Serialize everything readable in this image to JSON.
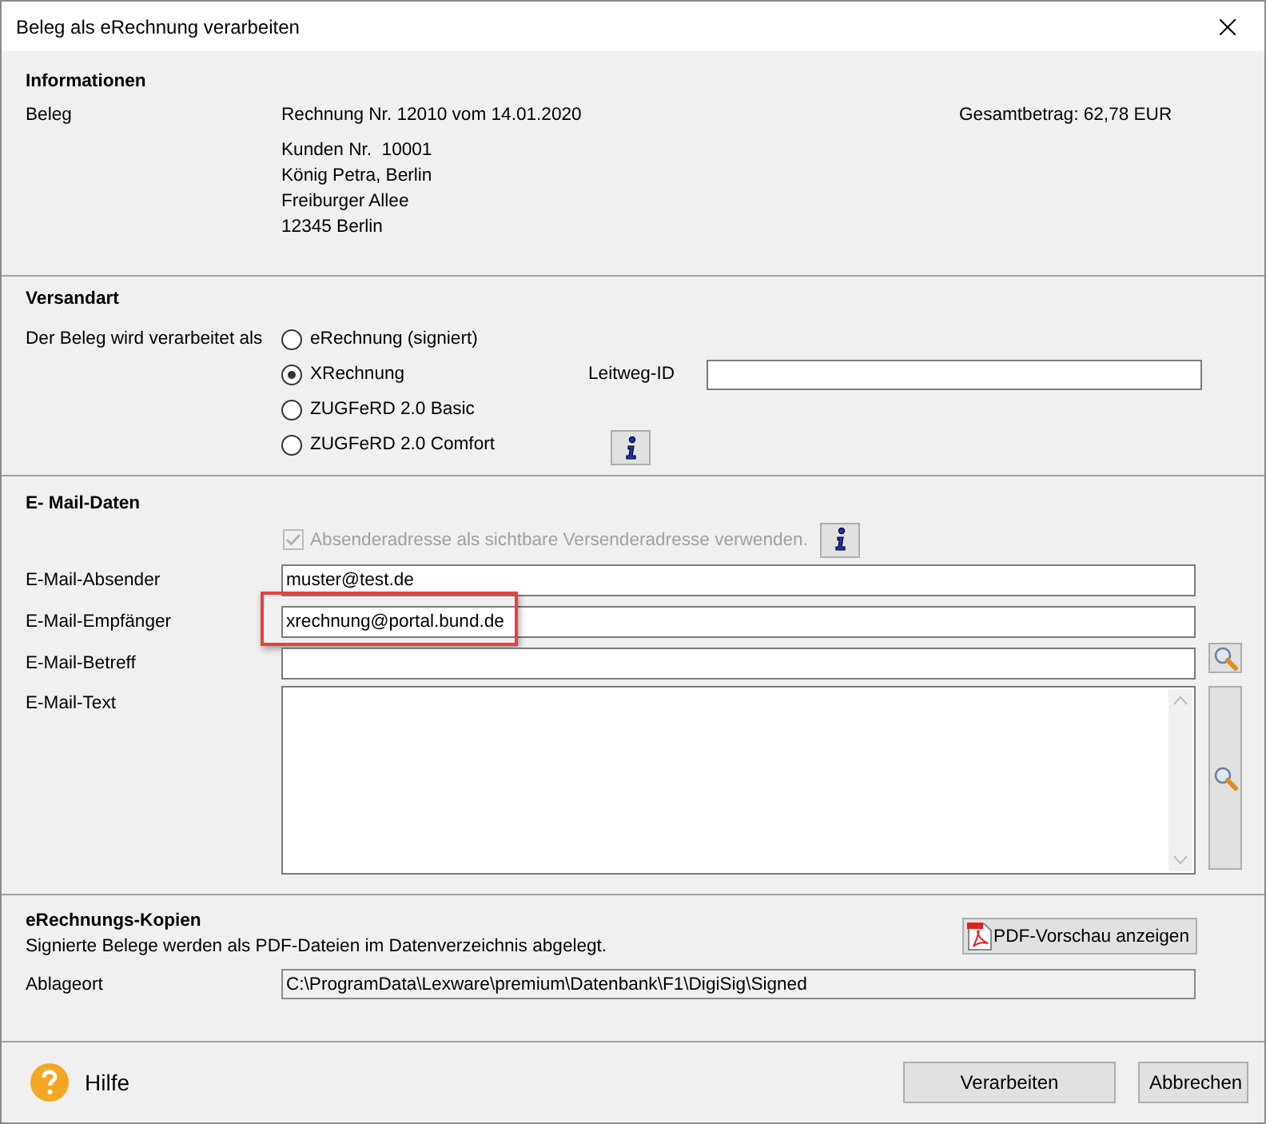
{
  "window": {
    "title": "Beleg als eRechnung verarbeiten"
  },
  "informationen": {
    "heading": "Informationen",
    "label": "Beleg",
    "document": "Rechnung Nr. 12010 vom 14.01.2020",
    "total": "Gesamtbetrag: 62,78 EUR",
    "address": [
      "Kunden Nr.  10001",
      "König Petra, Berlin",
      "Freiburger Allee",
      "12345 Berlin"
    ]
  },
  "versandart": {
    "heading": "Versandart",
    "label": "Der Beleg wird verarbeitet als",
    "options": [
      {
        "label": "eRechnung (signiert)",
        "selected": false
      },
      {
        "label": "XRechnung",
        "selected": true
      },
      {
        "label": "ZUGFeRD 2.0 Basic",
        "selected": false
      },
      {
        "label": "ZUGFeRD 2.0 Comfort",
        "selected": false
      }
    ],
    "leitweg": {
      "label": "Leitweg-ID"
    }
  },
  "email": {
    "heading": "E- Mail-Daten",
    "checkbox": {
      "label": "Absenderadresse als sichtbare Versenderadresse verwenden.",
      "checked": true,
      "disabled": true
    },
    "fields": [
      {
        "kind": "line",
        "label": "E-Mail-Absender",
        "value": "muster@test.de",
        "search": false,
        "highlighted": false
      },
      {
        "kind": "line",
        "label": "E-Mail-Empfänger",
        "value": "xrechnung@portal.bund.de",
        "search": false,
        "highlighted": true
      },
      {
        "kind": "line",
        "label": "E-Mail-Betreff",
        "search": true,
        "highlighted": false
      },
      {
        "kind": "text",
        "label": "E-Mail-Text",
        "search": true,
        "highlighted": false
      }
    ]
  },
  "kopien": {
    "heading": "eRechnungs-Kopien",
    "note": "Signierte Belege werden als PDF-Dateien im Datenverzeichnis abgelegt.",
    "preview_button": "PDF-Vorschau anzeigen",
    "location": {
      "label": "Ablageort",
      "value": "C:\\ProgramData\\Lexware\\premium\\Datenbank\\F1\\DigiSig\\Signed"
    }
  },
  "footer": {
    "help": "Hilfe",
    "buttons": [
      {
        "label": "Verarbeiten",
        "kind": "default"
      },
      {
        "label": "Abbrechen",
        "kind": "cancel"
      }
    ]
  }
}
